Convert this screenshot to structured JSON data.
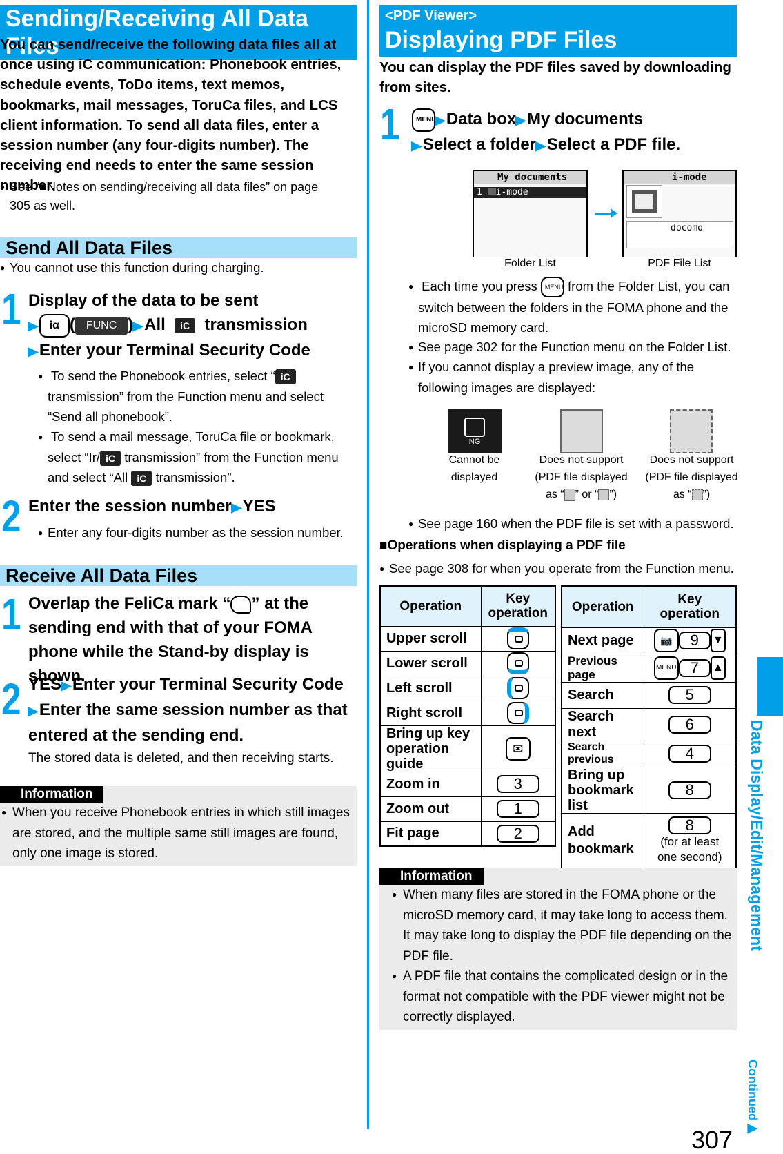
{
  "left": {
    "title": "Sending/Receiving All Data Files",
    "intro": "You can send/receive the following data files all at once using iC communication: Phonebook entries, schedule events, ToDo items, text memos, bookmarks, mail messages, ToruCa files, and LCS client information. To send all data files, enter a session number (any four-digits number). The receiving end needs to enter the same session number.",
    "note": "See “■Notes on sending/receiving all data files” on page 305 as well.",
    "send": {
      "title": "Send All Data Files",
      "note": "You cannot use this function during charging.",
      "step1": {
        "num": "1",
        "line1": "Display of the data to be sent",
        "key_label": "iα",
        "func_label": "FUNC",
        "all_label": "All",
        "ic_label": "iC",
        "transmission": "transmission",
        "line3": "Enter your Terminal Security Code",
        "bullet1_a": "To send the Phonebook entries, select “",
        "bullet1_b": " transmission” from the Function menu and select “Send all phonebook”.",
        "bullet2_a": "To send a mail message, ToruCa file or bookmark, select “Ir/",
        "bullet2_b": " transmission” from the Function menu and select “All ",
        "bullet2_c": " transmission”."
      },
      "step2": {
        "num": "2",
        "line1a": "Enter the session number",
        "line1b": "YES",
        "bullet": "Enter any four-digits number as the session number."
      }
    },
    "receive": {
      "title": "Receive All Data Files",
      "step1": {
        "num": "1",
        "text_a": "Overlap the FeliCa mark “",
        "text_b": "” at the sending end with that of your FOMA phone while the Stand-by display is shown."
      },
      "step2": {
        "num": "2",
        "a": "YES",
        "b": "Enter your Terminal Security Code",
        "c": "Enter the same session number as that entered at the sending end.",
        "note": "The stored data is deleted, and then receiving starts."
      }
    },
    "info": {
      "label": "Information",
      "items": [
        "When you receive Phonebook entries in which still images are stored, and the multiple same still images are found, only one image is stored."
      ]
    }
  },
  "right": {
    "subtitle": "<PDF Viewer>",
    "title": "Displaying PDF Files",
    "intro": "You can display the PDF files saved by downloading from sites.",
    "step1": {
      "num": "1",
      "menu_key": "MENU",
      "a": "Data box",
      "b": "My documents",
      "c": "Select a folder",
      "d": "Select a PDF file."
    },
    "screens": {
      "folder_list": {
        "bar": "My documents",
        "item_num": "1",
        "item": "i-mode",
        "caption": "Folder List"
      },
      "pdf_list": {
        "bar": "i-mode",
        "item": "docomo",
        "caption": "PDF File List"
      }
    },
    "bullets": [
      {
        "a": "Each time you press ",
        "key": "MENU",
        "b": " from the Folder List, you can switch between the folders in the FOMA phone and the microSD memory card."
      },
      {
        "a": "See page 302 for the Function menu on the Folder List."
      },
      {
        "a": "If you cannot display a preview image, any of the following images are displayed:"
      }
    ],
    "previews": [
      {
        "badge": "NG",
        "caption": "Cannot be displayed"
      },
      {
        "caption1": "Does not support",
        "caption2": "(PDF file displayed",
        "caption3a": "as “",
        "caption3b": "” or “",
        "caption3c": "”)"
      },
      {
        "caption1": "Does not support",
        "caption2": "(PDF file displayed",
        "caption3a": "as “",
        "caption3c": "”)"
      }
    ],
    "password_note": "See page 160 when the PDF file is set with a password.",
    "ops_heading": "■Operations when displaying a PDF file",
    "ops_note": "See page 308 for when you operate from the Function menu.",
    "table_left": {
      "headers": [
        "Operation",
        "Key operation"
      ],
      "rows": [
        {
          "op": "Upper scroll",
          "key": "nav-up"
        },
        {
          "op": "Lower scroll",
          "key": "nav-down"
        },
        {
          "op": "Left scroll",
          "key": "nav-left"
        },
        {
          "op": "Right scroll",
          "key": "nav-right"
        },
        {
          "op": "Bring up key operation guide",
          "key": "mail"
        },
        {
          "op": "Zoom in",
          "key": "3"
        },
        {
          "op": "Zoom out",
          "key": "1"
        },
        {
          "op": "Fit page",
          "key": "2"
        }
      ]
    },
    "table_right": {
      "headers": [
        "Operation",
        "Key operation"
      ],
      "rows": [
        {
          "op": "Next page",
          "keys": [
            "camera",
            "9",
            "▼"
          ]
        },
        {
          "op": "Previous page",
          "keys": [
            "MENU",
            "7",
            "▲"
          ]
        },
        {
          "op": "Search",
          "keys": [
            "5"
          ]
        },
        {
          "op": "Search next",
          "keys": [
            "6"
          ]
        },
        {
          "op": "Search previous",
          "keys": [
            "4"
          ]
        },
        {
          "op": "Bring up bookmark list",
          "keys": [
            "8"
          ]
        },
        {
          "op": "Add bookmark",
          "keys": [
            "8"
          ],
          "note": "(for at least one second)"
        }
      ]
    },
    "info": {
      "label": "Information",
      "items": [
        "When many files are stored in the FOMA phone or the microSD memory card, it may take long to access them. It may take long to display the PDF file depending on the PDF file.",
        "A PDF file that contains the complicated design or in the format not compatible with the PDF viewer might not be correctly displayed."
      ]
    }
  },
  "sidebar": {
    "section": "Data Display/Edit/Management",
    "continued": "Continued",
    "page_number": "307"
  },
  "colors": {
    "accent": "#00a0e9",
    "subheader": "#a6dff7",
    "table_header": "#e0f2fb",
    "info_bg": "#ebebeb"
  }
}
